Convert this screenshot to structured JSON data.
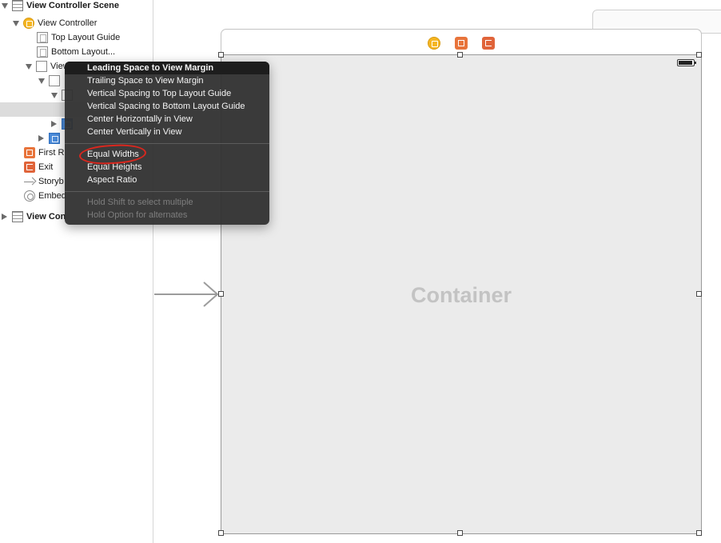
{
  "outline": {
    "items": [
      {
        "label": "View Controller Scene",
        "icon": "scene-icon",
        "disclosure": "down"
      },
      {
        "label": "View Controller",
        "icon": "view-controller-icon",
        "disclosure": "down"
      },
      {
        "label": "Top Layout Guide",
        "icon": "layout-guide-icon"
      },
      {
        "label": "Bottom Layout...",
        "icon": "layout-guide-icon"
      },
      {
        "label": "View",
        "icon": "view-icon",
        "disclosure": "down"
      },
      {
        "label": "",
        "icon": "view-icon",
        "disclosure": "down"
      },
      {
        "label": "",
        "icon": "view-icon",
        "disclosure": "down"
      },
      {
        "label": "",
        "selected": true
      },
      {
        "label": "",
        "icon": "blue-view-icon",
        "disclosure": "right"
      },
      {
        "label": "",
        "icon": "blue-view-icon",
        "disclosure": "right"
      },
      {
        "label": "First R",
        "icon": "first-responder-icon"
      },
      {
        "label": "Exit",
        "icon": "exit-icon"
      },
      {
        "label": "Storyb",
        "icon": "storyboard-entry-icon"
      },
      {
        "label": "Embed",
        "icon": "embed-segue-icon"
      },
      {
        "label": "View Con",
        "icon": "scene-icon",
        "disclosure": "right"
      }
    ]
  },
  "canvas": {
    "container_label": "Container",
    "dock_icons": [
      "view-controller-icon",
      "first-responder-icon",
      "exit-icon"
    ],
    "status_icon": "battery-icon"
  },
  "context_menu": {
    "items": [
      {
        "label": "Leading Space to View Margin",
        "highlighted": true
      },
      {
        "label": "Trailing Space to View Margin"
      },
      {
        "label": "Vertical Spacing to Top Layout Guide"
      },
      {
        "label": "Vertical Spacing to Bottom Layout Guide"
      },
      {
        "label": "Center Horizontally in View"
      },
      {
        "label": "Center Vertically in View"
      },
      {
        "label": "Equal Widths",
        "annotated": true
      },
      {
        "label": "Equal Heights"
      },
      {
        "label": "Aspect Ratio"
      },
      {
        "label": "Hold Shift to select multiple",
        "disabled": true
      },
      {
        "label": "Hold Option for alternates",
        "disabled": true
      }
    ]
  },
  "colors": {
    "menu_background": "#303030",
    "annotation_circle": "#d9271e",
    "view_controller_icon": "#f5b623",
    "first_responder_icon": "#e8743b"
  }
}
